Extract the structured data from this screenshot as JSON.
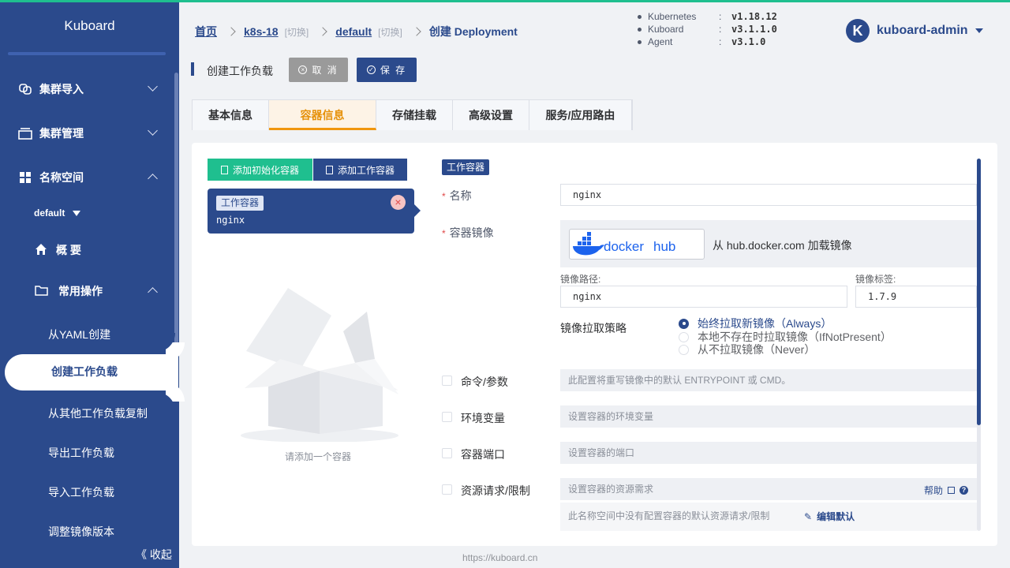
{
  "sidebar": {
    "brand": "Kuboard",
    "items": [
      {
        "label": "集群导入"
      },
      {
        "label": "集群管理"
      },
      {
        "label": "名称空间"
      }
    ],
    "namespace": "default",
    "overview": "概 要",
    "common_ops": "常用操作",
    "sub_items": [
      "从YAML创建",
      "创建工作负载",
      "从其他工作负载复制",
      "导出工作负载",
      "导入工作负载",
      "调整镜像版本"
    ],
    "active": "创建工作负载",
    "collapse": "《 收起"
  },
  "breadcrumb": {
    "home": "首页",
    "cluster": "k8s-18",
    "switch": "[切换]",
    "namespace": "default",
    "current": "创建 Deployment"
  },
  "versions": [
    {
      "name": "Kubernetes",
      "value": "v1.18.12"
    },
    {
      "name": "Kuboard",
      "value": "v3.1.1.0"
    },
    {
      "name": "Agent",
      "value": "v3.1.0"
    }
  ],
  "user": {
    "initial": "K",
    "name": "kuboard-admin"
  },
  "toolbar": {
    "title": "创建工作负载",
    "cancel": "取 消",
    "save": "保 存"
  },
  "tabs": [
    {
      "label": "基本信息",
      "active": false
    },
    {
      "label": "容器信息",
      "active": true
    },
    {
      "label": "存储挂载",
      "active": false
    },
    {
      "label": "高级设置",
      "active": false
    },
    {
      "label": "服务/应用路由",
      "active": false
    }
  ],
  "containers": {
    "add_init": "添加初始化容器",
    "add_work": "添加工作容器",
    "card_tag": "工作容器",
    "card_name": "nginx",
    "empty_text": "请添加一个容器"
  },
  "form": {
    "section_tag": "工作容器",
    "name_label": "名称",
    "name_value": "nginx",
    "image_label": "容器镜像",
    "dockerhub_text": "从 hub.docker.com 加载镜像",
    "image_path_label": "镜像路径:",
    "image_path_value": "nginx",
    "image_tag_label": "镜像标签:",
    "image_tag_value": "1.7.9",
    "pull_policy_label": "镜像拉取策略",
    "pull_policies": [
      {
        "label": "始终拉取新镜像（Always）",
        "selected": true
      },
      {
        "label": "本地不存在时拉取镜像（IfNotPresent）",
        "selected": false
      },
      {
        "label": "从不拉取镜像（Never）",
        "selected": false
      }
    ],
    "options": [
      {
        "label": "命令/参数",
        "hint": "此配置将重写镜像中的默认 ENTRYPOINT 或 CMD。"
      },
      {
        "label": "环境变量",
        "hint": "设置容器的环境变量"
      },
      {
        "label": "容器端口",
        "hint": "设置容器的端口"
      },
      {
        "label": "资源请求/限制",
        "hint": "设置容器的资源需求"
      }
    ],
    "help": "帮助",
    "resource_note": "此名称空间中没有配置容器的默认资源请求/限制",
    "edit_default": "编辑默认"
  },
  "footer": "https://kuboard.cn",
  "colors": {
    "primary": "#2b4a8c",
    "accent": "#1fbf8f",
    "tab_active": "#e6910a"
  }
}
